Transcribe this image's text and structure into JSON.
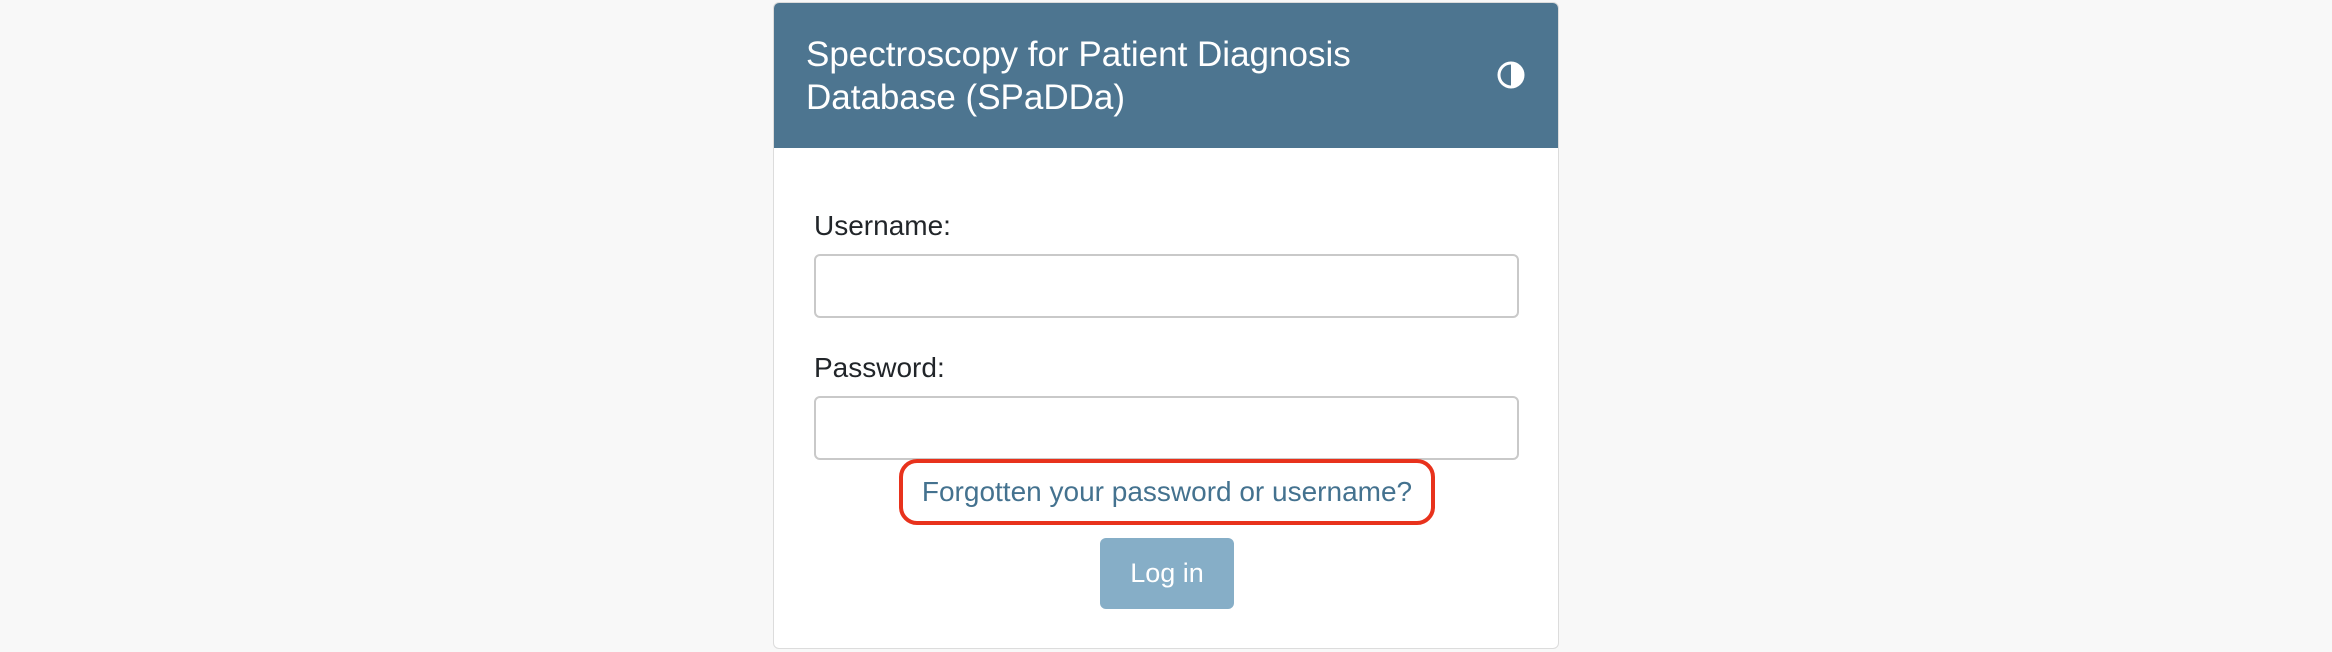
{
  "header": {
    "title": "Spectroscopy for Patient Diagnosis Database (SPaDDa)",
    "theme_toggle_icon": "contrast-half-circle-icon"
  },
  "form": {
    "username_label": "Username:",
    "username_value": "",
    "password_label": "Password:",
    "password_value": "",
    "forgot_link": "Forgotten your password or username?",
    "login_button": "Log in"
  },
  "colors": {
    "header_bg": "#4d7590",
    "link": "#44728f",
    "button_bg": "#86aec7",
    "highlight": "#e8321c",
    "page_bg": "#f8f8f8"
  }
}
